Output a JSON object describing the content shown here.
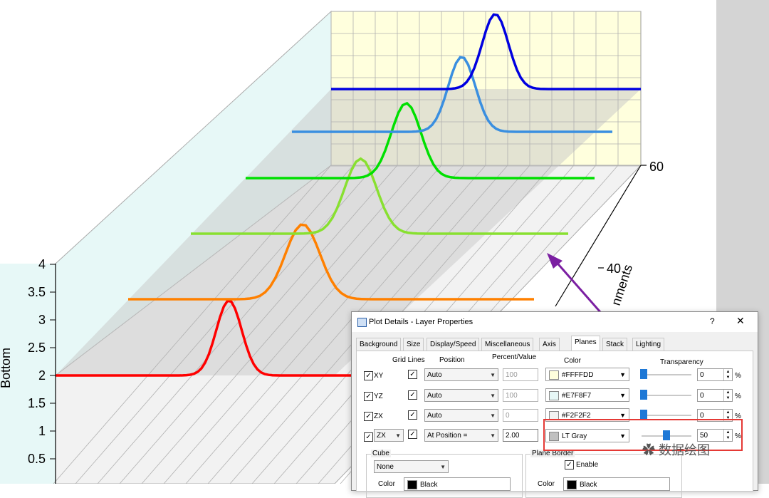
{
  "plot": {
    "y_axis_title": "Bottom",
    "y_ticks": [
      "4",
      "3.5",
      "3",
      "2.5",
      "2",
      "1.5",
      "1",
      "0.5"
    ],
    "z_ticks": [
      "60",
      "40"
    ],
    "z_axis_title_fragment": "nments",
    "colors": {
      "xy_plane": "#FFFFDD",
      "yz_plane": "#E7F8F7",
      "zx_plane": "#F2F2F2",
      "arrow": "#7b1fa2",
      "highlight": "#e53935"
    }
  },
  "chart_data": {
    "type": "line",
    "title": "",
    "ylabel": "Bottom",
    "ylim": [
      0,
      4
    ],
    "series": [
      {
        "color": "#ff0000",
        "values": [
          2,
          2,
          3.5,
          2,
          2,
          2
        ]
      },
      {
        "color": "#ff8000",
        "values": [
          2,
          2,
          3.5,
          2,
          2,
          2
        ]
      },
      {
        "color": "#88e030",
        "values": [
          2,
          2,
          3.5,
          2,
          2,
          2
        ]
      },
      {
        "color": "#00e000",
        "values": [
          2,
          2,
          3.5,
          2,
          2,
          2
        ]
      },
      {
        "color": "#3a8fe0",
        "values": [
          2,
          2,
          3.5,
          2,
          2,
          2
        ]
      },
      {
        "color": "#0000e0",
        "values": [
          2,
          2,
          3.5,
          2,
          2,
          2
        ]
      }
    ]
  },
  "dialog": {
    "title": "Plot Details - Layer Properties",
    "help": "?",
    "close": "✕",
    "tabs": [
      "Background",
      "Size",
      "Display/Speed",
      "Miscellaneous",
      "Axis",
      "Planes",
      "Stack",
      "Lighting"
    ],
    "active_tab": "Planes",
    "headers": {
      "grid_lines": "Grid Lines",
      "position": "Position",
      "percent_value": "Percent/Value",
      "color": "Color",
      "transparency": "Transparency"
    },
    "rows": [
      {
        "plane": "XY",
        "position": "Auto",
        "value": "100",
        "color_name": "#FFFFDD",
        "color": "#FFFFDD",
        "transparency": "0"
      },
      {
        "plane": "YZ",
        "position": "Auto",
        "value": "100",
        "color_name": "#E7F8F7",
        "color": "#E7F8F7",
        "transparency": "0"
      },
      {
        "plane": "ZX",
        "position": "Auto",
        "value": "0",
        "color_name": "#F2F2F2",
        "color": "#F2F2F2",
        "transparency": "0"
      }
    ],
    "extra_row": {
      "plane": "ZX",
      "position": "At Position =",
      "value": "2.00",
      "color_name": "LT Gray",
      "color": "#c0c0c0",
      "transparency": "50"
    },
    "percent_sign": "%",
    "cube": {
      "title": "Cube",
      "value": "None",
      "color_label": "Color",
      "color_value": "Black"
    },
    "plane_border": {
      "title": "Plane Border",
      "enable_label": "Enable",
      "color_label": "Color",
      "color_value": "Black"
    }
  },
  "watermark": "数据绘图"
}
